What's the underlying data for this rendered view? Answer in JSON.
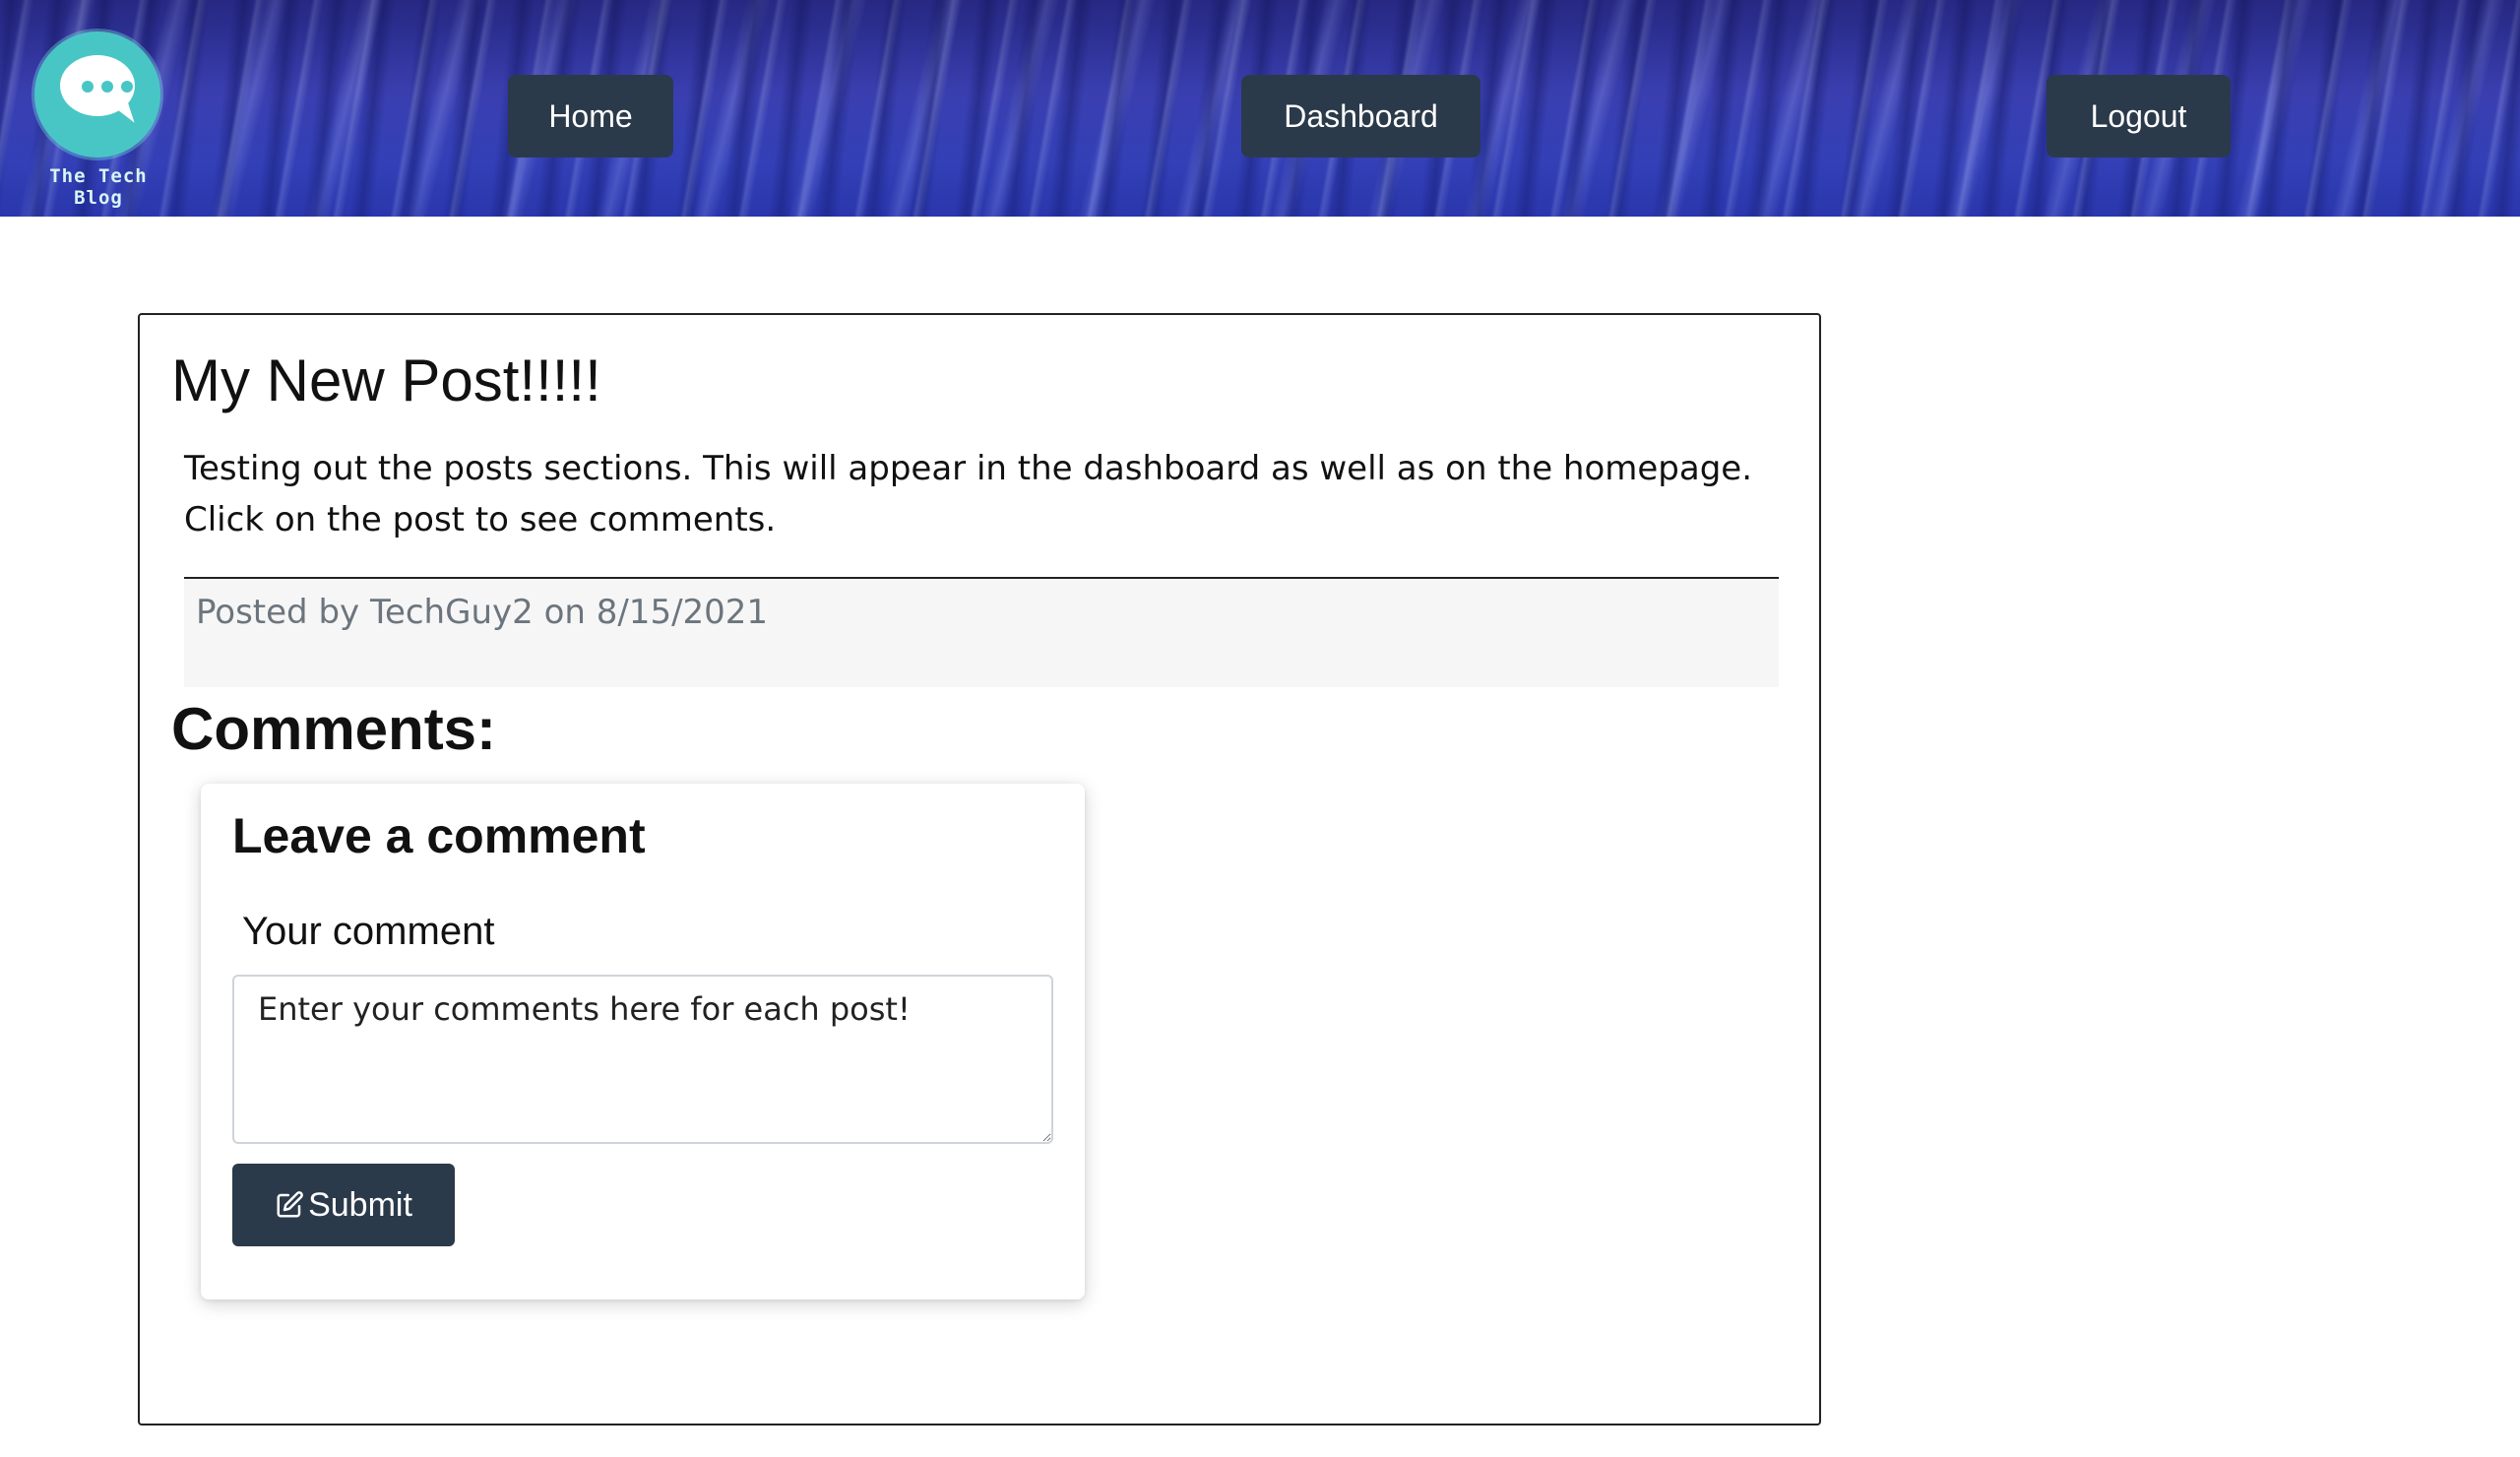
{
  "header": {
    "logo_text": "The Tech Blog",
    "nav": {
      "home": "Home",
      "dashboard": "Dashboard",
      "logout": "Logout"
    }
  },
  "post": {
    "title": "My New Post!!!!!",
    "body": "Testing out the posts sections. This will appear in the dashboard as well as on the homepage. Click on the post to see comments.",
    "meta": "Posted by TechGuy2 on 8/15/2021"
  },
  "comments": {
    "heading": "Comments:",
    "form": {
      "title": "Leave a comment",
      "label": "Your comment",
      "placeholder": "Enter your comments here for each post!",
      "submit_label": "Submit",
      "submit_icon": "edit-icon"
    }
  },
  "colors": {
    "nav_button": "#2b3a4a",
    "logo": "#48c6c6",
    "meta_text": "#6c757d"
  }
}
